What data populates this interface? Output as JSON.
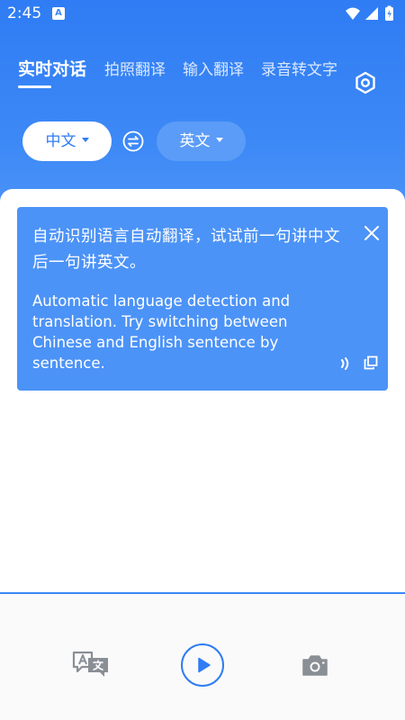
{
  "status_bar": {
    "time": "2:45",
    "notification_badge": "A",
    "icons": [
      "wifi-icon",
      "signal-icon",
      "battery-icon"
    ]
  },
  "tabs": [
    {
      "label": "实时对话",
      "active": true
    },
    {
      "label": "拍照翻译",
      "active": false
    },
    {
      "label": "输入翻译",
      "active": false
    },
    {
      "label": "录音转文字",
      "active": false
    }
  ],
  "languages": {
    "source": "中文",
    "target": "英文"
  },
  "card": {
    "source_text": "自动识别语言自动翻译，试试前一句讲中文后一句讲英文。",
    "translated_text": "Automatic language detection and translation. Try switching between Chinese and English sentence by sentence."
  },
  "bottom_bar": {
    "icons": [
      "translate-icon",
      "play-icon",
      "camera-icon"
    ]
  },
  "colors": {
    "primary": "#2f7cf4",
    "card": "#4c93f7",
    "secondary_pill": "#5b9cf8"
  }
}
